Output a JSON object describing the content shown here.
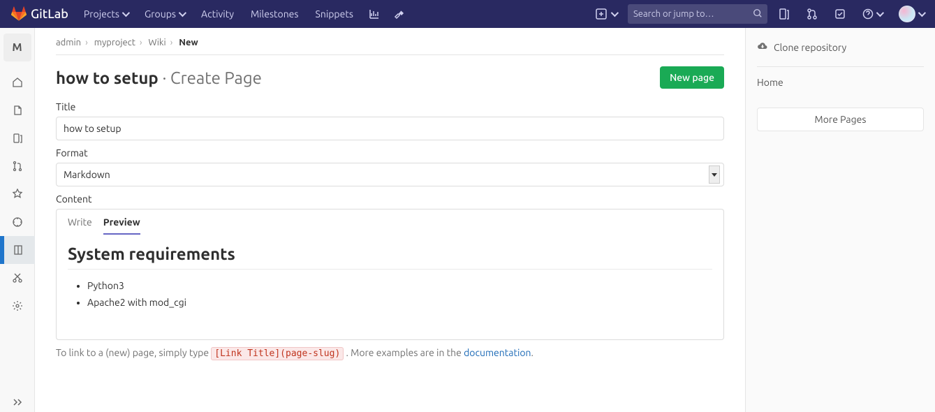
{
  "brand": "GitLab",
  "nav": {
    "projects": "Projects",
    "groups": "Groups",
    "activity": "Activity",
    "milestones": "Milestones",
    "snippets": "Snippets"
  },
  "search_placeholder": "Search or jump to…",
  "sidebar_avatar_letter": "M",
  "breadcrumb": {
    "admin": "admin",
    "project": "myproject",
    "wiki": "Wiki",
    "current": "New"
  },
  "page": {
    "title_bold": "how to setup",
    "title_light": "· Create Page",
    "new_page_btn": "New page"
  },
  "fields": {
    "title_label": "Title",
    "title_value": "how to setup",
    "format_label": "Format",
    "format_value": "Markdown",
    "content_label": "Content"
  },
  "tabs": {
    "write": "Write",
    "preview": "Preview"
  },
  "preview": {
    "heading": "System requirements",
    "items": [
      "Python3",
      "Apache2 with mod_cgi"
    ]
  },
  "hint": {
    "prefix": "To link to a (new) page, simply type ",
    "code": "[Link Title](page-slug)",
    "middle": ". More examples are in the ",
    "link": "documentation",
    "suffix": "."
  },
  "right": {
    "clone": "Clone repository",
    "home": "Home",
    "more": "More Pages"
  }
}
